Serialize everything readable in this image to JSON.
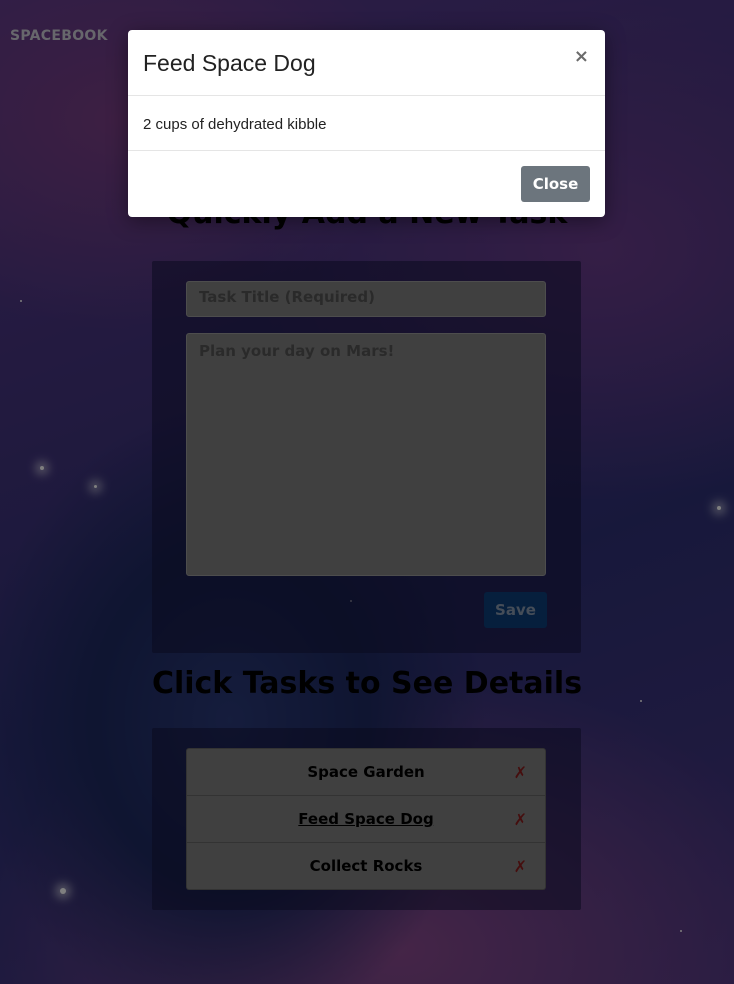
{
  "brand": "SPACEBOOK",
  "add_section": {
    "heading": "Quickly Add a New Task",
    "title_placeholder": "Task Title (Required)",
    "details_placeholder": "Plan your day on Mars!",
    "save_label": "Save"
  },
  "list_section": {
    "heading": "Click Tasks to See Details",
    "tasks": [
      {
        "title": "Space Garden",
        "delete_glyph": "✗"
      },
      {
        "title": "Feed Space Dog",
        "delete_glyph": "✗"
      },
      {
        "title": "Collect Rocks",
        "delete_glyph": "✗"
      }
    ]
  },
  "modal": {
    "title": "Feed Space Dog",
    "close_glyph": "×",
    "body": "2 cups of dehydrated kibble",
    "close_label": "Close"
  },
  "colors": {
    "save_button": "#0d3e7a",
    "close_button": "#6c757d",
    "delete_icon": "#8b1d1d"
  }
}
